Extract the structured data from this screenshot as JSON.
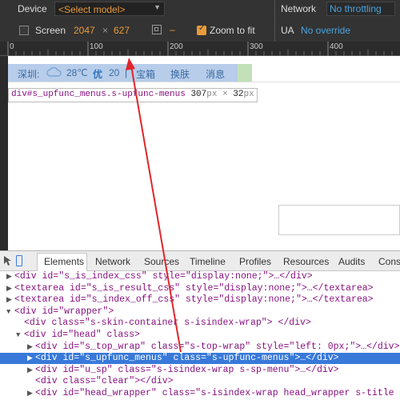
{
  "emulation": {
    "device_label": "Device",
    "model_select": "<Select model>",
    "network_label": "Network",
    "network_value": "No throttling",
    "screen_label": "Screen",
    "screen_width": "2047",
    "screen_x": "×",
    "screen_height": "627",
    "dash": "–",
    "zoom_label": "Zoom to fit",
    "ua_label": "UA",
    "ua_value": "No override"
  },
  "ruler": {
    "ticks": [
      "0",
      "100",
      "200",
      "300",
      "400"
    ]
  },
  "page": {
    "menu": {
      "city": "深圳:",
      "temp": "28℃",
      "quality": "优",
      "aqi": "20",
      "sep": "|",
      "items": [
        "宝箱",
        "换肤",
        "消息"
      ]
    },
    "tooltip": {
      "selector": "div#s_upfunc_menus.s-upfunc-menus",
      "width": "307",
      "px1": "px",
      "x": "×",
      "height": "32",
      "px2": "px"
    }
  },
  "devtools": {
    "tabs": [
      "Elements",
      "Network",
      "Sources",
      "Timeline",
      "Profiles",
      "Resources",
      "Audits",
      "Cons"
    ],
    "lines": [
      {
        "indent": 1,
        "tri": "▶",
        "text": "<div id=\"s_is_index_css\" style=\"display:none;\">…</div>"
      },
      {
        "indent": 1,
        "tri": "▶",
        "text": "<textarea id=\"s_is_result_css\" style=\"display:none;\">…</textarea>"
      },
      {
        "indent": 1,
        "tri": "▶",
        "text": "<textarea id=\"s_index_off_css\" style=\"display:none;\">…</textarea>"
      },
      {
        "indent": 1,
        "tri": "▼",
        "text": "<div id=\"wrapper\">"
      },
      {
        "indent": 2,
        "tri": "",
        "text": "<div class=\"s-skin-container s-isindex-wrap\">  </div>"
      },
      {
        "indent": 2,
        "tri": "▼",
        "text": "<div id=\"head\" class>"
      },
      {
        "indent": 3,
        "tri": "▶",
        "text": "<div id=\"s_top_wrap\" class=\"s-top-wrap\" style=\"left: 0px;\">…</div>"
      },
      {
        "indent": 3,
        "tri": "▶",
        "text": "<div id=\"s_upfunc_menus\" class=\"s-upfunc-menus\">…</div>",
        "selected": true
      },
      {
        "indent": 3,
        "tri": "▶",
        "text": "<div id=\"u_sp\" class=\"s-isindex-wrap s-sp-menu\">…</div>"
      },
      {
        "indent": 3,
        "tri": "",
        "text": "<div class=\"clear\"></div>"
      },
      {
        "indent": 3,
        "tri": "▶",
        "text": "<div id=\"head_wrapper\" class=\"s-isindex-wrap head_wrapper s-title"
      }
    ]
  },
  "colors": {
    "accent": "#e89b3b",
    "link": "#4aa3df",
    "selection": "#3879d9",
    "arrow": "#e0262a"
  }
}
